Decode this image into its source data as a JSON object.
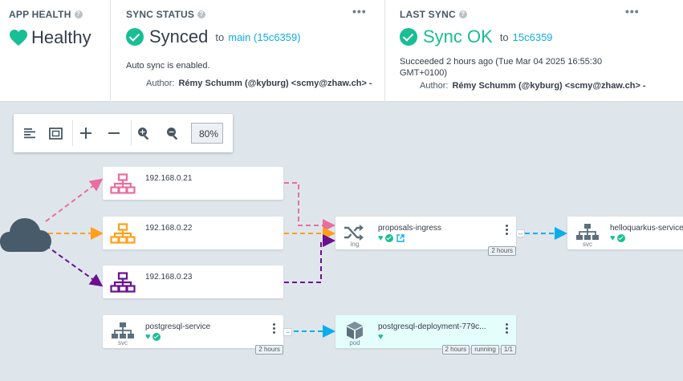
{
  "app_health": {
    "title": "APP HEALTH",
    "help": "?",
    "status": "Healthy",
    "color": "#18be94"
  },
  "sync_status": {
    "title": "SYNC STATUS",
    "help": "?",
    "menu": "•••",
    "status": "Synced",
    "to_label": "to",
    "target": "main (15c6359)",
    "detail": "Auto sync is enabled.",
    "author_label": "Author:",
    "author": "Rémy Schumm (@kyburg) <scmy@zhaw.ch> -"
  },
  "last_sync": {
    "title": "LAST SYNC",
    "help": "?",
    "menu": "•••",
    "status": "Sync OK",
    "to_label": "to",
    "target": "15c6359",
    "detail": "Succeeded 2 hours ago (Tue Mar 04 2025 16:55:30 GMT+0100)",
    "author_label": "Author:",
    "author": "Rémy Schumm (@kyburg) <scmy@zhaw.ch> -"
  },
  "toolbar": {
    "zoom": "80%",
    "buttons": [
      "align-left-icon",
      "fit-screen-icon",
      "plus-icon",
      "minus-icon",
      "zoom-in-icon",
      "zoom-out-icon"
    ]
  },
  "graph": {
    "networks": [
      {
        "label": "192.168.0.21",
        "color": "#e96d9f"
      },
      {
        "label": "192.168.0.22",
        "color": "#ff9f1a"
      },
      {
        "label": "192.168.0.23",
        "color": "#6a0f8e"
      }
    ],
    "ingress": {
      "name": "proposals-ingress",
      "kind": "ing",
      "age": "2 hours"
    },
    "hello_service": {
      "name": "helloquarkus-service",
      "kind": "svc"
    },
    "pg_service": {
      "name": "postgresql-service",
      "kind": "svc",
      "age": "2 hours"
    },
    "pg_pod": {
      "name": "postgresql-deployment-779c...",
      "kind": "pod",
      "age": "2 hours",
      "state": "running",
      "ready": "1/1"
    },
    "edge_color": "#0dadea",
    "minus": "–"
  }
}
